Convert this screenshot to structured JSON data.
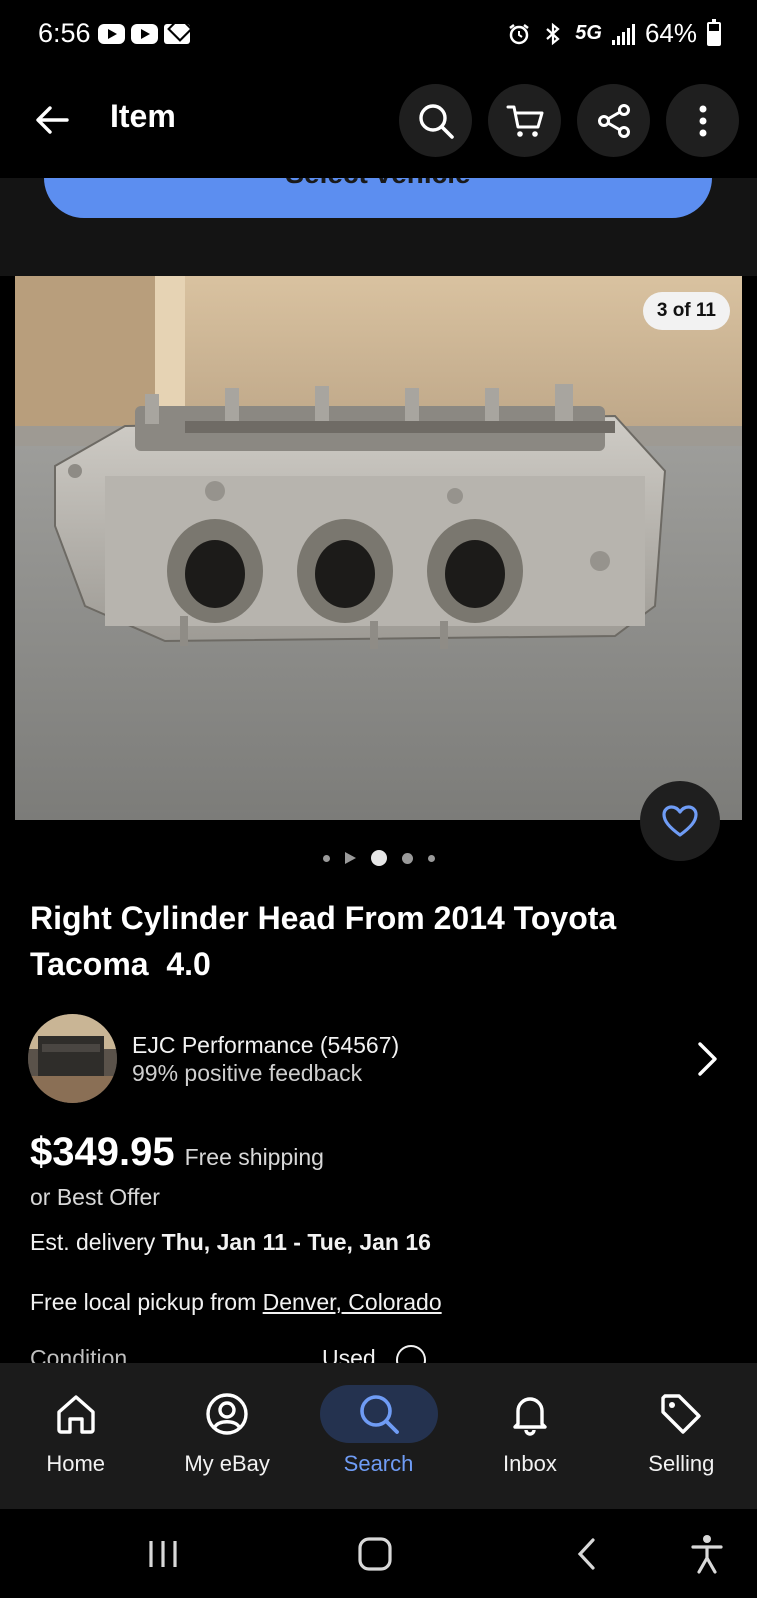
{
  "status_bar": {
    "time": "6:56",
    "network": "5G",
    "battery": "64%"
  },
  "header": {
    "title": "Item",
    "icons": [
      "back-arrow-icon",
      "search-icon",
      "cart-icon",
      "share-icon",
      "more-vert-icon"
    ]
  },
  "vehicle": {
    "button_label": "Select vehicle"
  },
  "gallery": {
    "counter": "3 of 11",
    "current_index": 3,
    "total": 11
  },
  "item": {
    "title": "Right Cylinder Head From 2014 Toyota\nTacoma  4.0"
  },
  "seller": {
    "name": "EJC Performance (54567)",
    "feedback": "99% positive feedback"
  },
  "pricing": {
    "price": "$349.95",
    "shipping": "Free shipping",
    "offer": "or Best Offer"
  },
  "delivery": {
    "prefix": "Est. delivery ",
    "dates": "Thu, Jan 11 - Tue, Jan 16"
  },
  "pickup": {
    "prefix": "Free local pickup from ",
    "location": "Denver, Colorado"
  },
  "condition": {
    "label": "Condition",
    "value": "Used"
  },
  "bottom_nav": {
    "items": [
      {
        "label": "Home",
        "icon": "home-icon"
      },
      {
        "label": "My eBay",
        "icon": "user-circle-icon"
      },
      {
        "label": "Search",
        "icon": "search-icon"
      },
      {
        "label": "Inbox",
        "icon": "bell-icon"
      },
      {
        "label": "Selling",
        "icon": "tag-icon"
      }
    ],
    "active": "Search"
  },
  "colors": {
    "accent": "#5c8ef0",
    "nav_active_text": "#6f9cf5",
    "nav_active_bg": "#24324f",
    "background": "#000000"
  }
}
